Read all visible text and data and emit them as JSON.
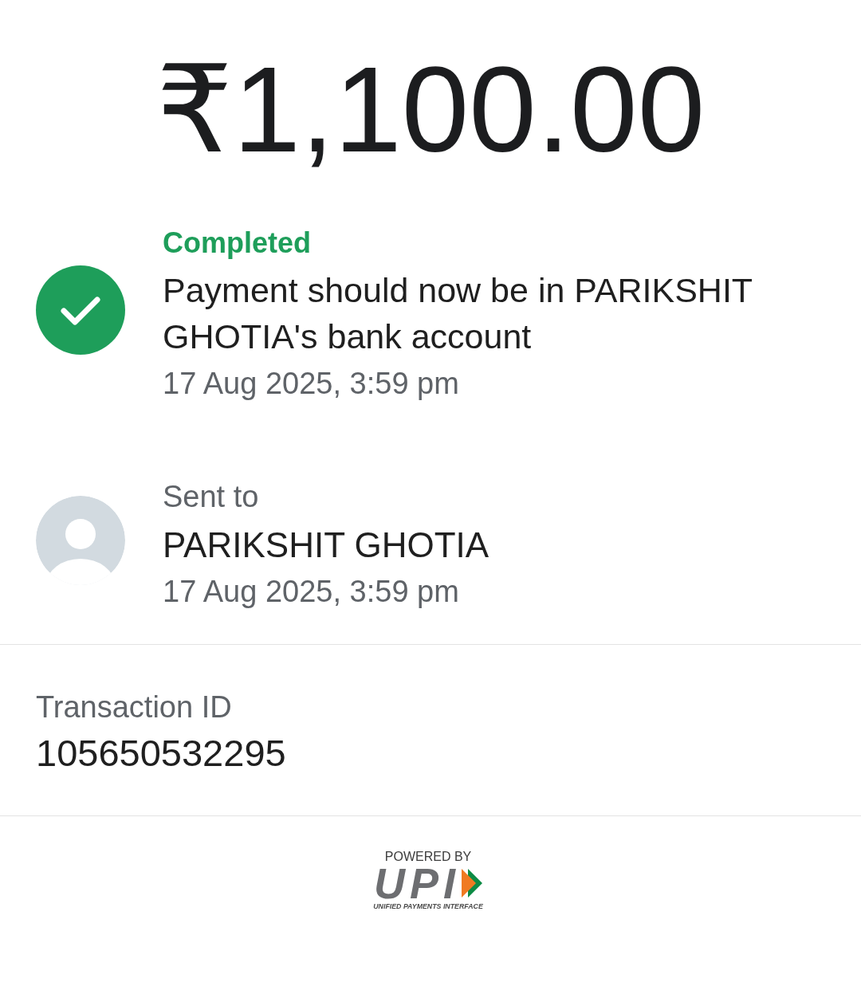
{
  "amount": "₹1,100.00",
  "status": {
    "kind": "completed",
    "label": "Completed",
    "message": "Payment should now be in PARIKSHIT GHOTIA's bank account",
    "time": "17 Aug 2025, 3:59 pm"
  },
  "recipient": {
    "label": "Sent to",
    "name": "PARIKSHIT GHOTIA",
    "time": "17 Aug 2025, 3:59 pm"
  },
  "transaction": {
    "label": "Transaction ID",
    "value": "105650532295"
  },
  "footer": {
    "powered_by": "POWERED BY",
    "logo_text": "UPI",
    "tagline": "UNIFIED PAYMENTS INTERFACE"
  }
}
